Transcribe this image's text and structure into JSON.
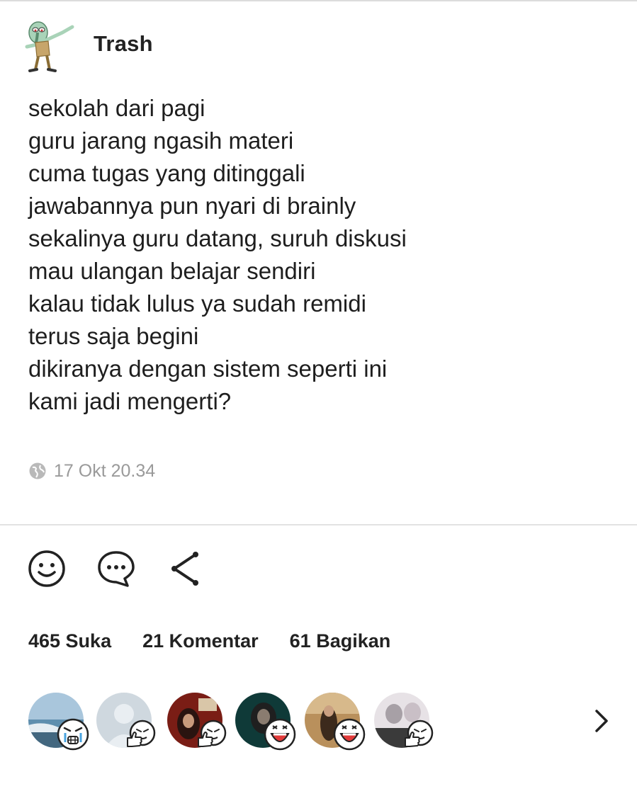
{
  "post": {
    "author": "Trash",
    "lines": [
      "sekolah dari pagi",
      "guru jarang ngasih materi",
      "cuma tugas yang ditinggali",
      "jawabannya pun nyari di brainly",
      "sekalinya guru datang, suruh diskusi",
      "mau ulangan belajar sendiri",
      "kalau tidak lulus ya sudah remidi",
      "terus saja begini",
      "dikiranya dengan sistem seperti ini",
      "kami jadi mengerti?"
    ],
    "timestamp": "17 Okt 20.34",
    "visibility_icon": "globe-icon"
  },
  "actions": {
    "icons": [
      "smiley-icon",
      "comment-icon",
      "share-icon"
    ]
  },
  "stats": {
    "likes": "465 Suka",
    "comments": "21 Komentar",
    "shares": "61 Bagikan"
  },
  "reactors": {
    "items": [
      {
        "photo": "sea-photo",
        "sticker": "crying-sticker-icon"
      },
      {
        "photo": "blank-avatar",
        "sticker": "thumbs-up-sticker-icon"
      },
      {
        "photo": "dark-red-photo",
        "sticker": "thumbs-up-sticker-icon"
      },
      {
        "photo": "dark-teal-photo",
        "sticker": "laughing-sticker-icon"
      },
      {
        "photo": "warm-photo",
        "sticker": "laughing-sticker-icon"
      },
      {
        "photo": "bw-photo",
        "sticker": "thumbs-up-sticker-icon"
      }
    ],
    "more_icon": "chevron-right-icon"
  },
  "colors": {
    "text": "#1e1e1e",
    "muted": "#9a9a9a",
    "divider": "#e2e2e2"
  }
}
